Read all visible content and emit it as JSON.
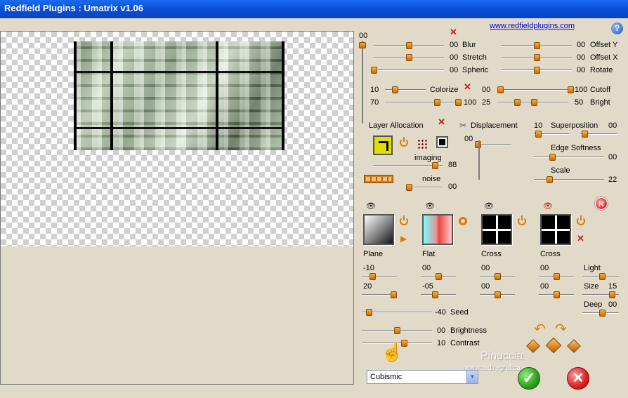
{
  "window": {
    "title": "Redfield Plugins : Umatrix v1.06",
    "link": "www.redfieldplugins.com",
    "help": "?"
  },
  "top": {
    "v00": "00",
    "blur": {
      "label": "Blur",
      "value": "00"
    },
    "stretch": {
      "label": "Stretch",
      "value": "00"
    },
    "spheric": {
      "label": "Spheric",
      "value": "00"
    },
    "offsety": {
      "label": "Offset Y",
      "value": "00"
    },
    "offsetx": {
      "label": "Offset X",
      "value": "00"
    },
    "rotate": {
      "label": "Rotate",
      "value": "00"
    },
    "colorize": {
      "label": "Colorize",
      "left": "10",
      "right": "100",
      "left2": "70"
    },
    "cutoff": {
      "label": "Cutoff",
      "left": "00",
      "right": "100"
    },
    "bright": {
      "label": "Bright",
      "left": "25",
      "right": "50"
    }
  },
  "layer": {
    "label": "Layer Allocation",
    "imaging": "imaging",
    "imaging_value": "88",
    "noise": "noise",
    "noise_value": "00"
  },
  "displacement": {
    "label": "Displacement",
    "value": "00",
    "superposition": "Superposition",
    "sp_left": "10",
    "sp_right": "00",
    "edge": "Edge Softness",
    "edge_value": "00",
    "scale": "Scale",
    "scale_value": "22"
  },
  "layers": [
    {
      "name": "Plane",
      "v1": "-10",
      "v2": "20"
    },
    {
      "name": "Flat",
      "v1": "00",
      "v2": "-05"
    },
    {
      "name": "Cross",
      "v1": "00",
      "v2": "00"
    },
    {
      "name": "Cross",
      "v1": "00",
      "v2": "00"
    }
  ],
  "light": {
    "light": "Light",
    "size": "Size",
    "size_value": "15",
    "deep": "Deep",
    "deep_value": "00"
  },
  "bottom": {
    "seed": "Seed",
    "seed_value": "-40",
    "brightness": "Brightness",
    "brightness_value": "00",
    "contrast": "Contrast",
    "contrast_value": "10"
  },
  "preset": "Cubismic",
  "watermark": {
    "name": "Pinuccia",
    "site": "www.maidiregrafica.eu"
  },
  "buttons": {
    "ok": "✓",
    "cancel": "✕",
    "r": "R"
  }
}
